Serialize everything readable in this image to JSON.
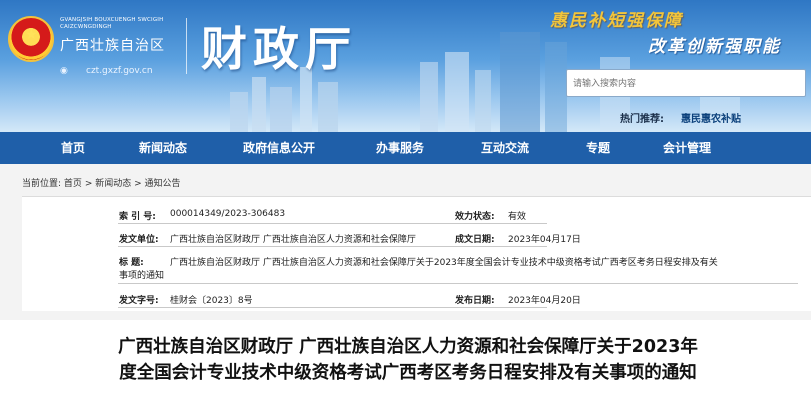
{
  "header": {
    "pinyin_line1": "GVANGJSIH BOUXCUENGH SWCIGIH",
    "pinyin_line2": "CAIZCWNGDINGH",
    "region_name": "广西壮族自治区",
    "site_url": "czt.gxzf.gov.cn",
    "dept_name": "财政厅",
    "slogan_1": "惠民补短强保障",
    "slogan_2": "改革创新强职能",
    "search_placeholder": "请输入搜索内容",
    "hot_label": "热门推荐:",
    "hot_link": "惠民惠农补贴"
  },
  "nav": {
    "items": [
      "首页",
      "新闻动态",
      "政府信息公开",
      "办事服务",
      "互动交流",
      "专题",
      "会计管理"
    ]
  },
  "breadcrumb": {
    "prefix": "当前位置:",
    "items": [
      "首页",
      "新闻动态",
      "通知公告"
    ],
    "separator": ">"
  },
  "info": {
    "index_label": "索  引  号:",
    "index_value": "000014349/2023-306483",
    "validity_label": "效力状态:",
    "validity_value": "有效",
    "issuer_label": "发文单位:",
    "issuer_value": "广西壮族自治区财政厅    广西壮族自治区人力资源和社会保障厅",
    "created_label": "成文日期:",
    "created_value": "2023年04月17日",
    "title_label": "标        题:",
    "title_value_line1": "广西壮族自治区财政厅    广西壮族自治区人力资源和社会保障厅关于2023年度全国会计专业技术中级资格考试广西考区考务日程安排及有关",
    "title_value_line2": "事项的通知",
    "docno_label": "发文字号:",
    "docno_value": "桂财会〔2023〕8号",
    "published_label": "发布日期:",
    "published_value": "2023年04月20日"
  },
  "article": {
    "title_line1": "广西壮族自治区财政厅    广西壮族自治区人力资源和社会保障厅关于2023年",
    "title_line2": "度全国会计专业技术中级资格考试广西考区考务日程安排及有关事项的通知"
  },
  "colors": {
    "nav_bg": "#1f5fa9",
    "header_top": "#2f77c4",
    "slogan_gold": "#f3c53a"
  }
}
